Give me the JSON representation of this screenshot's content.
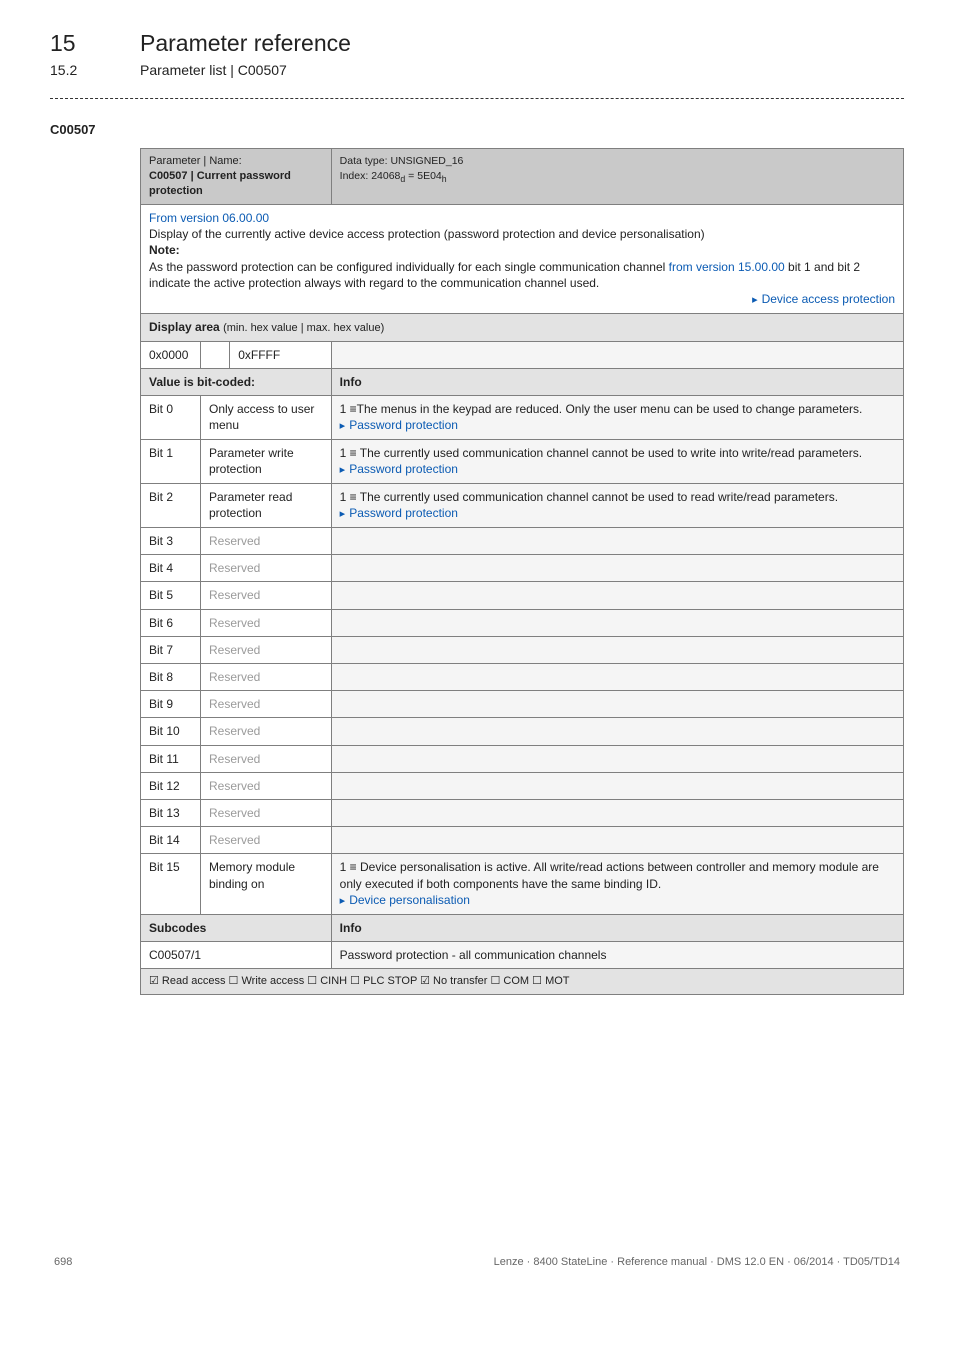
{
  "chapter": {
    "num": "15",
    "title": "Parameter reference"
  },
  "section": {
    "num": "15.2",
    "title": "Parameter list | C00507"
  },
  "param_id": "C00507",
  "header": {
    "left_label": "Parameter | Name:",
    "name_bold": "C00507 | Current password protection",
    "data_type": "Data type: UNSIGNED_16",
    "index": "Index: 24068",
    "index_sub": "d",
    "index_eq": " = 5E04",
    "index_sub2": "h"
  },
  "desc": {
    "from_version": "From version 06.00.00",
    "line1": "Display of the currently active device access protection (password protection and device personalisation)",
    "note_label": "Note:",
    "line2a": "As the password protection can be configured individually for each single communication channel ",
    "line2b": "from version 15.00.00",
    "line2c": " bit 1 and bit 2 indicate the active protection always with regard to the communication channel used.",
    "link": "Device access protection"
  },
  "display_area_label": "Display area",
  "display_area_sub": "(min. hex value | max. hex value)",
  "range_min": "0x0000",
  "range_max": "0xFFFF",
  "value_coded_label": "Value is bit-coded:",
  "info_label": "Info",
  "bits": [
    {
      "bit": "Bit 0",
      "name": "Only access to user menu",
      "info_lines": [
        "1 ≡The menus in the keypad are reduced. Only the user menu can be used to change parameters."
      ],
      "link": "Password protection"
    },
    {
      "bit": "Bit 1",
      "name": "Parameter write protection",
      "info_lines": [
        "1 ≡ The currently used communication channel cannot be used to write into write/read parameters."
      ],
      "link": "Password protection"
    },
    {
      "bit": "Bit 2",
      "name": "Parameter read protection",
      "info_lines": [
        "1 ≡ The currently used communication channel cannot be used to read write/read parameters."
      ],
      "link": "Password protection"
    },
    {
      "bit": "Bit 3",
      "name": "Reserved",
      "info_lines": [],
      "link": ""
    },
    {
      "bit": "Bit 4",
      "name": "Reserved",
      "info_lines": [],
      "link": ""
    },
    {
      "bit": "Bit 5",
      "name": "Reserved",
      "info_lines": [],
      "link": ""
    },
    {
      "bit": "Bit 6",
      "name": "Reserved",
      "info_lines": [],
      "link": ""
    },
    {
      "bit": "Bit 7",
      "name": "Reserved",
      "info_lines": [],
      "link": ""
    },
    {
      "bit": "Bit 8",
      "name": "Reserved",
      "info_lines": [],
      "link": ""
    },
    {
      "bit": "Bit 9",
      "name": "Reserved",
      "info_lines": [],
      "link": ""
    },
    {
      "bit": "Bit 10",
      "name": "Reserved",
      "info_lines": [],
      "link": ""
    },
    {
      "bit": "Bit 11",
      "name": "Reserved",
      "info_lines": [],
      "link": ""
    },
    {
      "bit": "Bit 12",
      "name": "Reserved",
      "info_lines": [],
      "link": ""
    },
    {
      "bit": "Bit 13",
      "name": "Reserved",
      "info_lines": [],
      "link": ""
    },
    {
      "bit": "Bit 14",
      "name": "Reserved",
      "info_lines": [],
      "link": ""
    },
    {
      "bit": "Bit 15",
      "name": "Memory module binding on",
      "info_lines": [
        "1 ≡ Device personalisation is active. All write/read actions between controller and memory module are only executed if both components have the same binding ID."
      ],
      "link": "Device personalisation"
    }
  ],
  "subcodes_label": "Subcodes",
  "subcode_row": {
    "code": "C00507/1",
    "info": "Password protection - all communication channels"
  },
  "access_row": "☑ Read access   ☐ Write access   ☐ CINH   ☐ PLC STOP   ☑ No transfer   ☐ COM   ☐ MOT",
  "footer": {
    "page": "698",
    "text": "Lenze · 8400 StateLine · Reference manual · DMS 12.0 EN · 06/2014 · TD05/TD14"
  }
}
